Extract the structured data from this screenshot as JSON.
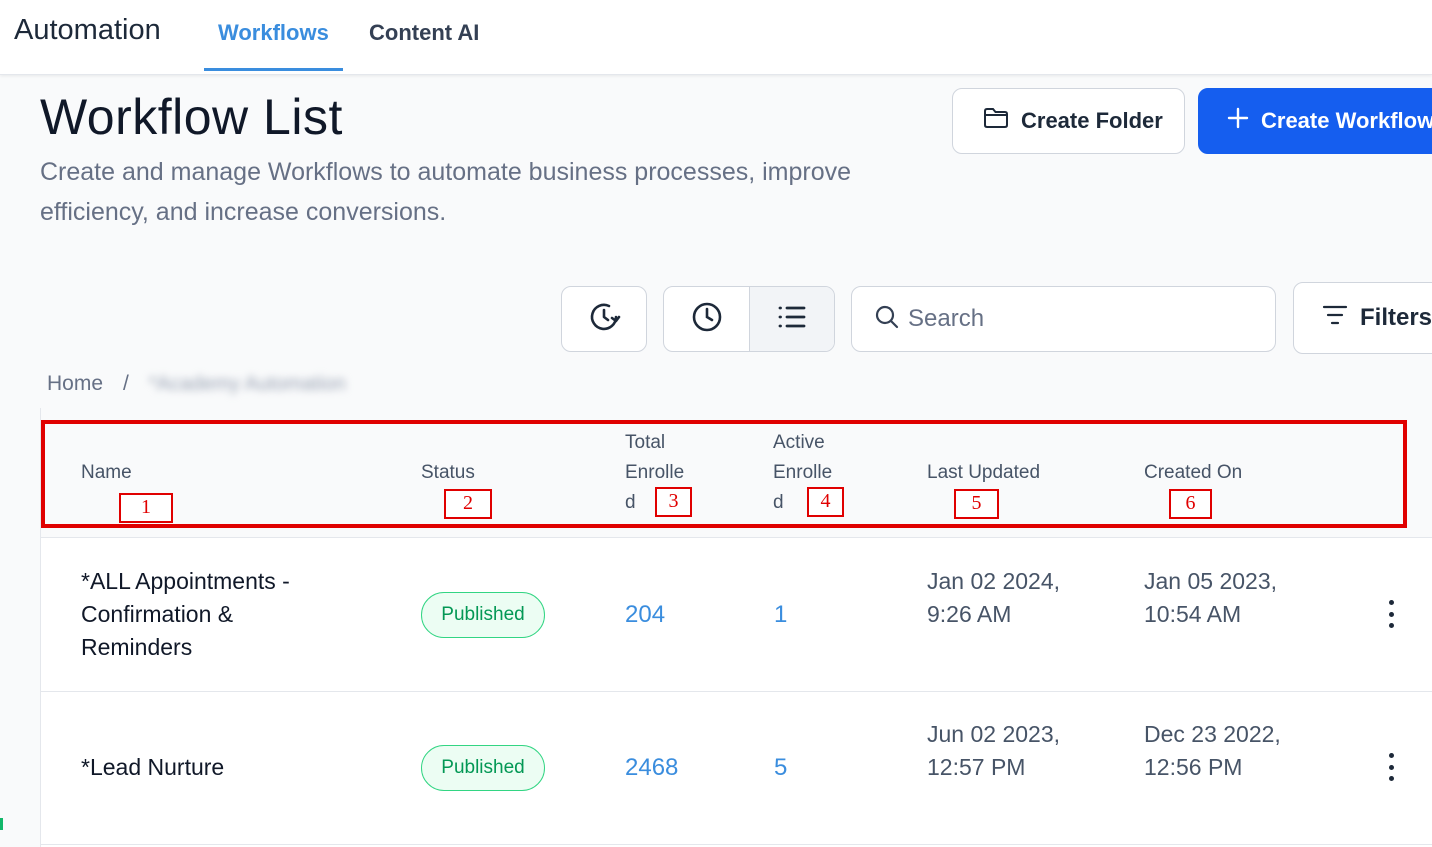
{
  "topnav": {
    "app_title": "Automation",
    "tabs": [
      {
        "label": "Workflows",
        "active": true
      },
      {
        "label": "Content AI",
        "active": false
      }
    ]
  },
  "header": {
    "title": "Workflow List",
    "subtitle": "Create and manage Workflows to automate business processes, improve efficiency, and increase conversions.",
    "create_folder_label": "Create Folder",
    "create_workflow_label": "Create Workflow"
  },
  "toolbar": {
    "history_icon": "history-clock-icon",
    "view_icons": [
      "clock-icon",
      "list-icon"
    ],
    "active_view": "list",
    "search_placeholder": "Search",
    "filters_label": "Filters"
  },
  "breadcrumb": {
    "home": "Home",
    "separator": "/",
    "current": "*Academy Automation"
  },
  "table": {
    "columns": [
      {
        "label": "Name"
      },
      {
        "label": "Status"
      },
      {
        "label_lines": [
          "Total",
          "Enrolle",
          "d"
        ]
      },
      {
        "label_lines": [
          "Active",
          "Enrolle",
          "d"
        ]
      },
      {
        "label": "Last Updated"
      },
      {
        "label": "Created On"
      }
    ],
    "annotation_numbers": [
      "1",
      "2",
      "3",
      "4",
      "5",
      "6"
    ],
    "rows": [
      {
        "name": "*ALL Appointments - Confirmation & Reminders",
        "status": "Published",
        "total_enrolled": "204",
        "active_enrolled": "1",
        "last_updated": "Jan 02 2024, 9:26 AM",
        "created_on": "Jan 05 2023, 10:54 AM"
      },
      {
        "name": "*Lead Nurture",
        "status": "Published",
        "total_enrolled": "2468",
        "active_enrolled": "5",
        "last_updated": "Jun 02 2023, 12:57 PM",
        "created_on": "Dec 23 2022, 12:56 PM"
      }
    ]
  },
  "colors": {
    "accent": "#3a8dde",
    "primary_button": "#155eef",
    "published_text": "#039855",
    "annotation_red": "#e00000"
  }
}
